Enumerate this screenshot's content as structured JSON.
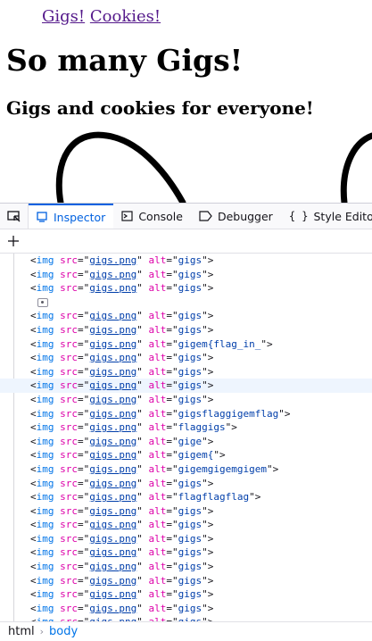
{
  "page": {
    "nav_links": [
      "Gigs!",
      "Cookies!"
    ],
    "heading": "So many Gigs!",
    "subheading": "Gigs and cookies for everyone!"
  },
  "devtools": {
    "tabs": [
      {
        "label": "Inspector",
        "icon": "inspector-icon",
        "active": true
      },
      {
        "label": "Console",
        "icon": "console-icon",
        "active": false
      },
      {
        "label": "Debugger",
        "icon": "debugger-icon",
        "active": false
      },
      {
        "label": "Style Editor",
        "icon": "style-editor-icon",
        "active": false
      }
    ],
    "accent_color": "#0061e0",
    "markup_tag": "img",
    "attr_src": "src",
    "attr_alt": "alt",
    "src_value": "gigs.png",
    "lines": [
      {
        "alt": "gigs"
      },
      {
        "alt": "gigs"
      },
      {
        "alt": "gigs"
      },
      {
        "whitespace": true
      },
      {
        "alt": "gigs"
      },
      {
        "alt": "gigs"
      },
      {
        "alt": "gigem{flag_in_"
      },
      {
        "alt": "gigs"
      },
      {
        "alt": "gigs"
      },
      {
        "alt": "gigs",
        "highlight": true
      },
      {
        "alt": "gigs"
      },
      {
        "alt": "gigsflaggigemflag"
      },
      {
        "alt": "flaggigs"
      },
      {
        "alt": "gige"
      },
      {
        "alt": "gigem{"
      },
      {
        "alt": "gigemgigemgigem"
      },
      {
        "alt": "gigs"
      },
      {
        "alt": "flagflagflag"
      },
      {
        "alt": "gigs"
      },
      {
        "alt": "gigs"
      },
      {
        "alt": "gigs"
      },
      {
        "alt": "gigs"
      },
      {
        "alt": "gigs"
      },
      {
        "alt": "gigs"
      },
      {
        "alt": "gigs"
      },
      {
        "alt": "gigs"
      },
      {
        "alt": "gigs"
      }
    ],
    "breadcrumbs": [
      "html",
      "body"
    ]
  }
}
